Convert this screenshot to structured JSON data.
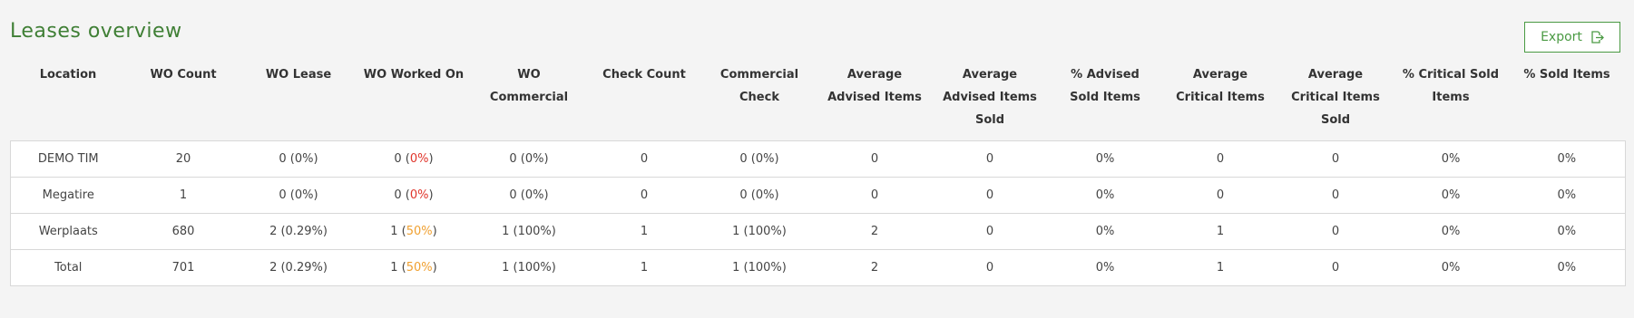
{
  "page": {
    "title": "Leases overview",
    "export_label": "Export"
  },
  "colors": {
    "title": "#3f7f35",
    "accent": "#4a9a43",
    "red": "#e0352b",
    "orange": "#f0a030"
  },
  "icons": {
    "export": "export-file-icon"
  },
  "table": {
    "headers": [
      "Location",
      "WO Count",
      "WO Lease",
      "WO Worked On",
      "WO Commercial",
      "Check Count",
      "Commercial Check",
      "Average Advised Items",
      "Average Advised Items Sold",
      "% Advised Sold Items",
      "Average Critical Items",
      "Average Critical Items Sold",
      "% Critical Sold Items",
      "% Sold Items"
    ],
    "rows": [
      {
        "location": "DEMO TIM",
        "wo_count": "20",
        "wo_lease": "0 (0%)",
        "wo_worked_on_value": "0",
        "wo_worked_on_pct": "0%",
        "wo_worked_on_color": "red",
        "wo_commercial": "0 (0%)",
        "check_count": "0",
        "commercial_check": "0 (0%)",
        "avg_advised": "0",
        "avg_advised_sold": "0",
        "pct_advised_sold": "0%",
        "avg_critical": "0",
        "avg_critical_sold": "0",
        "pct_critical_sold": "0%",
        "pct_sold": "0%"
      },
      {
        "location": "Megatire",
        "wo_count": "1",
        "wo_lease": "0 (0%)",
        "wo_worked_on_value": "0",
        "wo_worked_on_pct": "0%",
        "wo_worked_on_color": "red",
        "wo_commercial": "0 (0%)",
        "check_count": "0",
        "commercial_check": "0 (0%)",
        "avg_advised": "0",
        "avg_advised_sold": "0",
        "pct_advised_sold": "0%",
        "avg_critical": "0",
        "avg_critical_sold": "0",
        "pct_critical_sold": "0%",
        "pct_sold": "0%"
      },
      {
        "location": "Werplaats",
        "wo_count": "680",
        "wo_lease": "2 (0.29%)",
        "wo_worked_on_value": "1",
        "wo_worked_on_pct": "50%",
        "wo_worked_on_color": "orange",
        "wo_commercial": "1 (100%)",
        "check_count": "1",
        "commercial_check": "1 (100%)",
        "avg_advised": "2",
        "avg_advised_sold": "0",
        "pct_advised_sold": "0%",
        "avg_critical": "1",
        "avg_critical_sold": "0",
        "pct_critical_sold": "0%",
        "pct_sold": "0%"
      },
      {
        "location": "Total",
        "wo_count": "701",
        "wo_lease": "2 (0.29%)",
        "wo_worked_on_value": "1",
        "wo_worked_on_pct": "50%",
        "wo_worked_on_color": "orange",
        "wo_commercial": "1 (100%)",
        "check_count": "1",
        "commercial_check": "1 (100%)",
        "avg_advised": "2",
        "avg_advised_sold": "0",
        "pct_advised_sold": "0%",
        "avg_critical": "1",
        "avg_critical_sold": "0",
        "pct_critical_sold": "0%",
        "pct_sold": "0%"
      }
    ]
  }
}
